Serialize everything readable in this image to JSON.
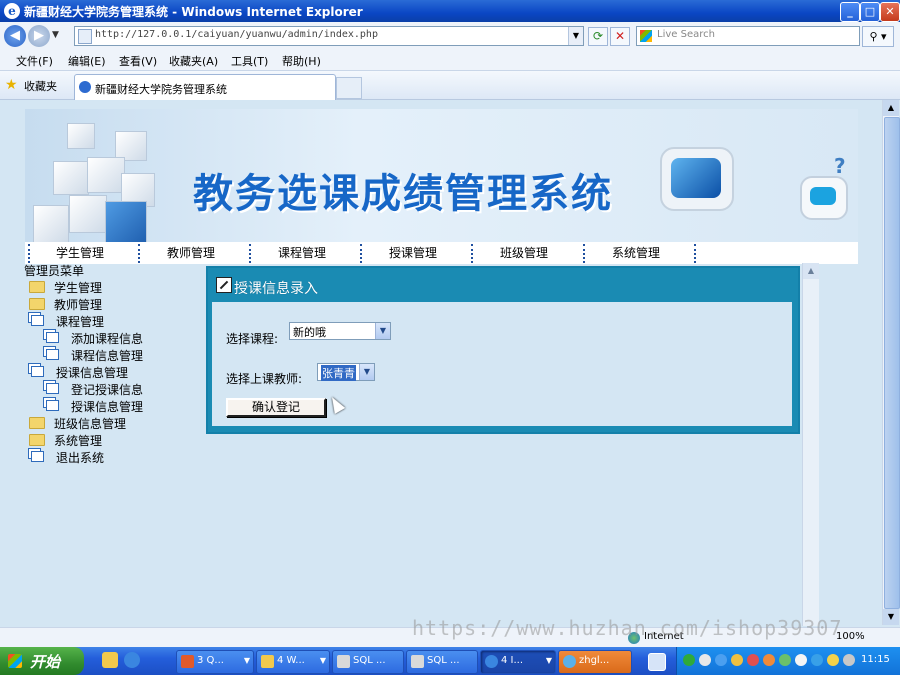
{
  "window": {
    "title": "新疆财经大学院务管理系统 - Windows Internet Explorer",
    "min": "_",
    "max": "□",
    "close": "✕"
  },
  "address_bar": {
    "url": "http://127.0.0.1/caiyuan/yuanwu/admin/index.php",
    "search_placeholder": "Live Search"
  },
  "menu": [
    "文件(F)",
    "编辑(E)",
    "查看(V)",
    "收藏夹(A)",
    "工具(T)",
    "帮助(H)"
  ],
  "favorites": {
    "label": "收藏夹",
    "tab_title": "新疆财经大学院务管理系统"
  },
  "banner": {
    "title": "教务选课成绩管理系统"
  },
  "topnav": [
    "学生管理",
    "教师管理",
    "课程管理",
    "授课管理",
    "班级管理",
    "系统管理"
  ],
  "sidebar": {
    "title": "管理员菜单",
    "items": [
      {
        "label": "学生管理",
        "icon": "folder-icon",
        "indent": 0
      },
      {
        "label": "教师管理",
        "icon": "folder-icon",
        "indent": 0
      },
      {
        "label": "课程管理",
        "icon": "page-icon",
        "indent": 0
      },
      {
        "label": "添加课程信息",
        "icon": "page-icon",
        "indent": 1
      },
      {
        "label": "课程信息管理",
        "icon": "page-icon",
        "indent": 1
      },
      {
        "label": "授课信息管理",
        "icon": "page-icon",
        "indent": 0
      },
      {
        "label": "登记授课信息",
        "icon": "page-icon",
        "indent": 1
      },
      {
        "label": "授课信息管理",
        "icon": "page-icon",
        "indent": 1
      },
      {
        "label": "班级信息管理",
        "icon": "folder-icon",
        "indent": 0
      },
      {
        "label": "系统管理",
        "icon": "folder-icon",
        "indent": 0
      },
      {
        "label": "退出系统",
        "icon": "page-icon",
        "indent": 0
      }
    ]
  },
  "panel": {
    "title": "授课信息录入",
    "course_label": "选择课程:",
    "course_value": "新的哦",
    "teacher_label": "选择上课教师:",
    "teacher_value": "张青青",
    "confirm_label": "确认登记"
  },
  "status": {
    "zone": "Internet",
    "zoom": "100%"
  },
  "watermark": "https://www.huzhan.com/ishop39307",
  "taskbar": {
    "start": "开始",
    "tasks": [
      "3 Q...",
      "4 W...",
      "SQL ...",
      "SQL ...",
      "4 I...",
      "zhgl..."
    ],
    "clock": "11:15"
  }
}
